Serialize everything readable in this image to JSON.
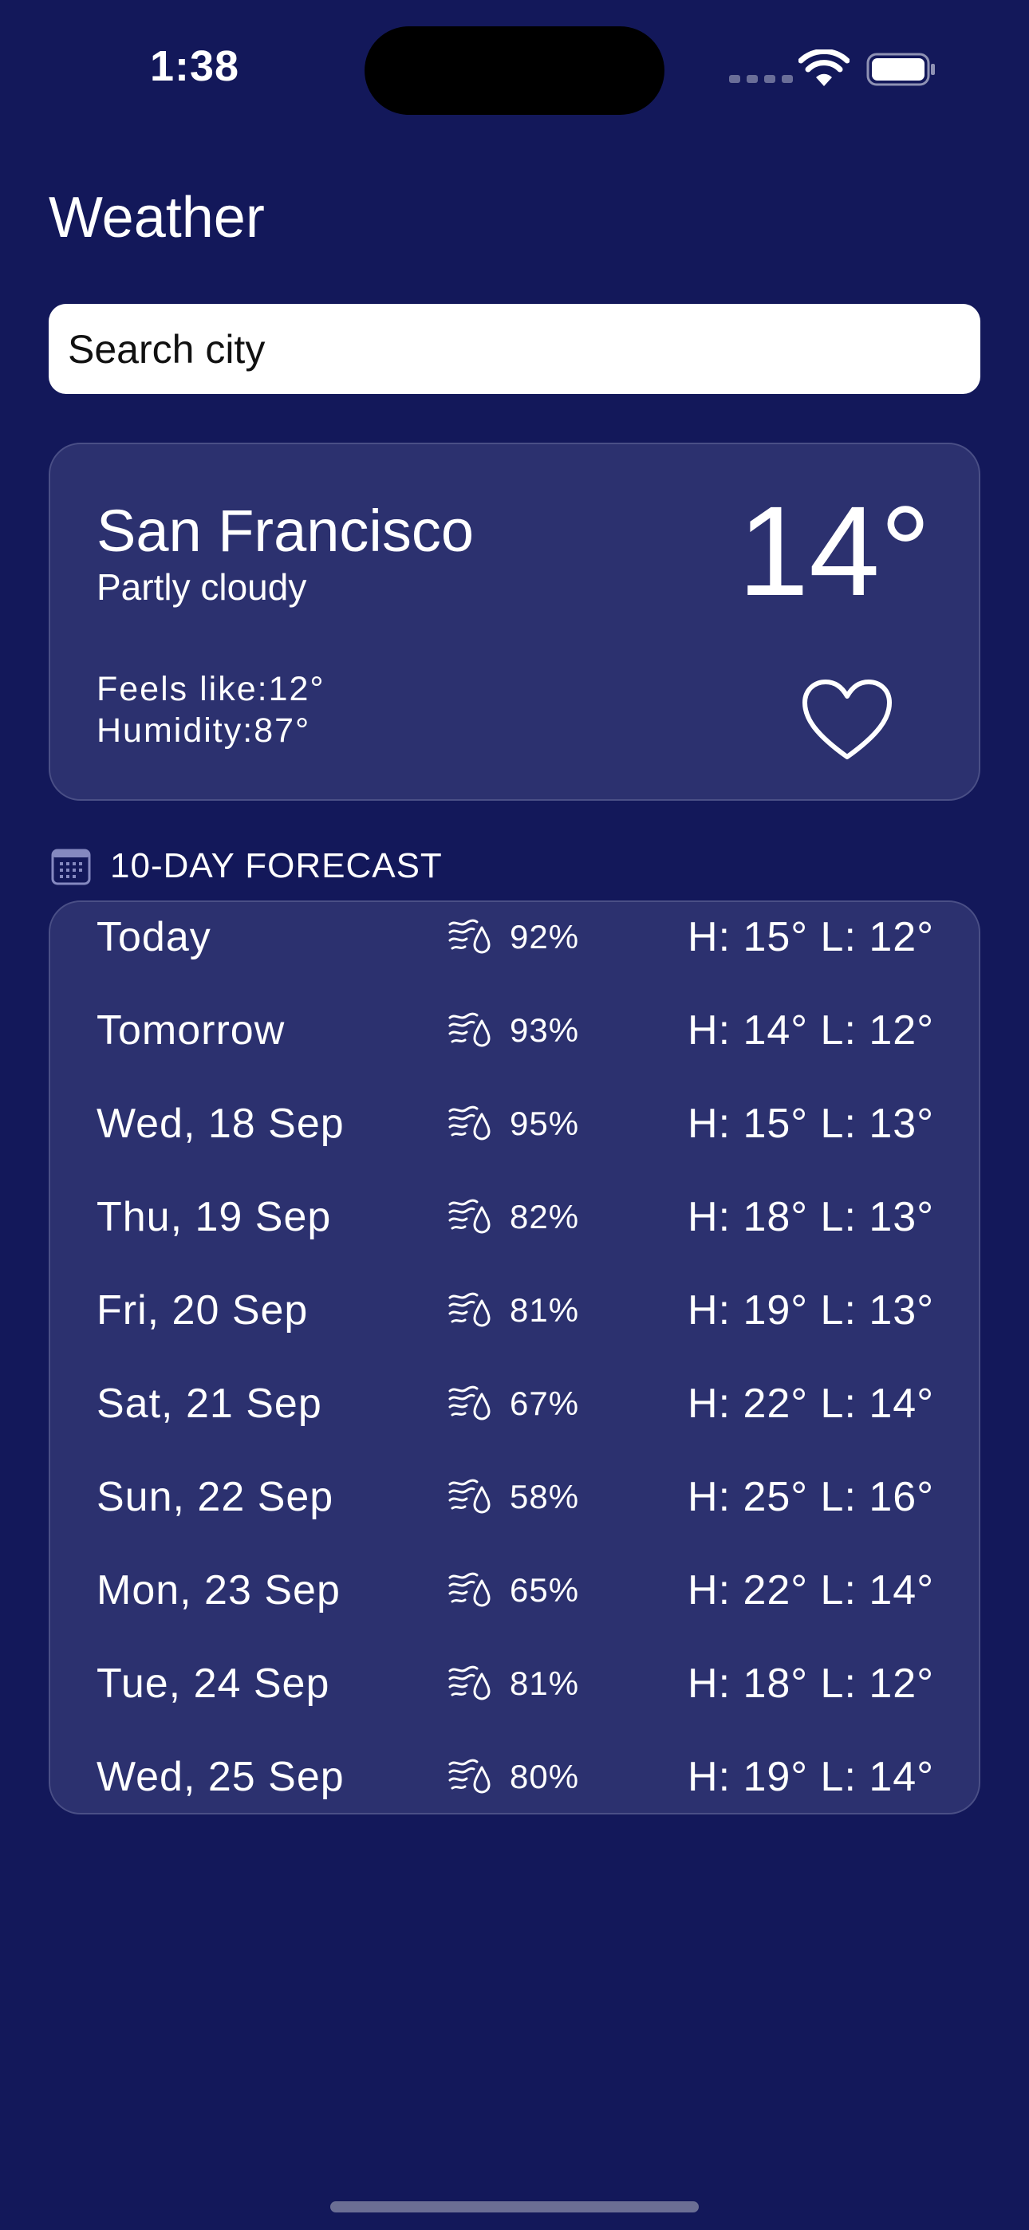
{
  "status_bar": {
    "time": "1:38"
  },
  "page_title": "Weather",
  "search": {
    "placeholder": "Search city",
    "value": ""
  },
  "current": {
    "city": "San Francisco",
    "condition": "Partly cloudy",
    "temperature": "14°",
    "feels_like": "Feels like:12°",
    "humidity": "Humidity:87°",
    "favorite_icon": "heart-outline-icon"
  },
  "forecast": {
    "header": "10-DAY FORECAST",
    "header_icon": "calendar-icon",
    "row_icon": "wind-rain-icon",
    "days": [
      {
        "day": "Today",
        "precip": "92%",
        "hl": "H: 15° L: 12°"
      },
      {
        "day": "Tomorrow",
        "precip": "93%",
        "hl": "H: 14° L: 12°"
      },
      {
        "day": "Wed, 18 Sep",
        "precip": "95%",
        "hl": "H: 15° L: 13°"
      },
      {
        "day": "Thu, 19 Sep",
        "precip": "82%",
        "hl": "H: 18° L: 13°"
      },
      {
        "day": "Fri, 20 Sep",
        "precip": "81%",
        "hl": "H: 19° L: 13°"
      },
      {
        "day": "Sat, 21 Sep",
        "precip": "67%",
        "hl": "H: 22° L: 14°"
      },
      {
        "day": "Sun, 22 Sep",
        "precip": "58%",
        "hl": "H: 25° L: 16°"
      },
      {
        "day": "Mon, 23 Sep",
        "precip": "65%",
        "hl": "H: 22° L: 14°"
      },
      {
        "day": "Tue, 24 Sep",
        "precip": "81%",
        "hl": "H: 18° L: 12°"
      },
      {
        "day": "Wed, 25 Sep",
        "precip": "80%",
        "hl": "H: 19° L: 14°"
      }
    ]
  },
  "colors": {
    "background": "#13185a",
    "card": "#2c316f",
    "text": "#ffffff"
  }
}
